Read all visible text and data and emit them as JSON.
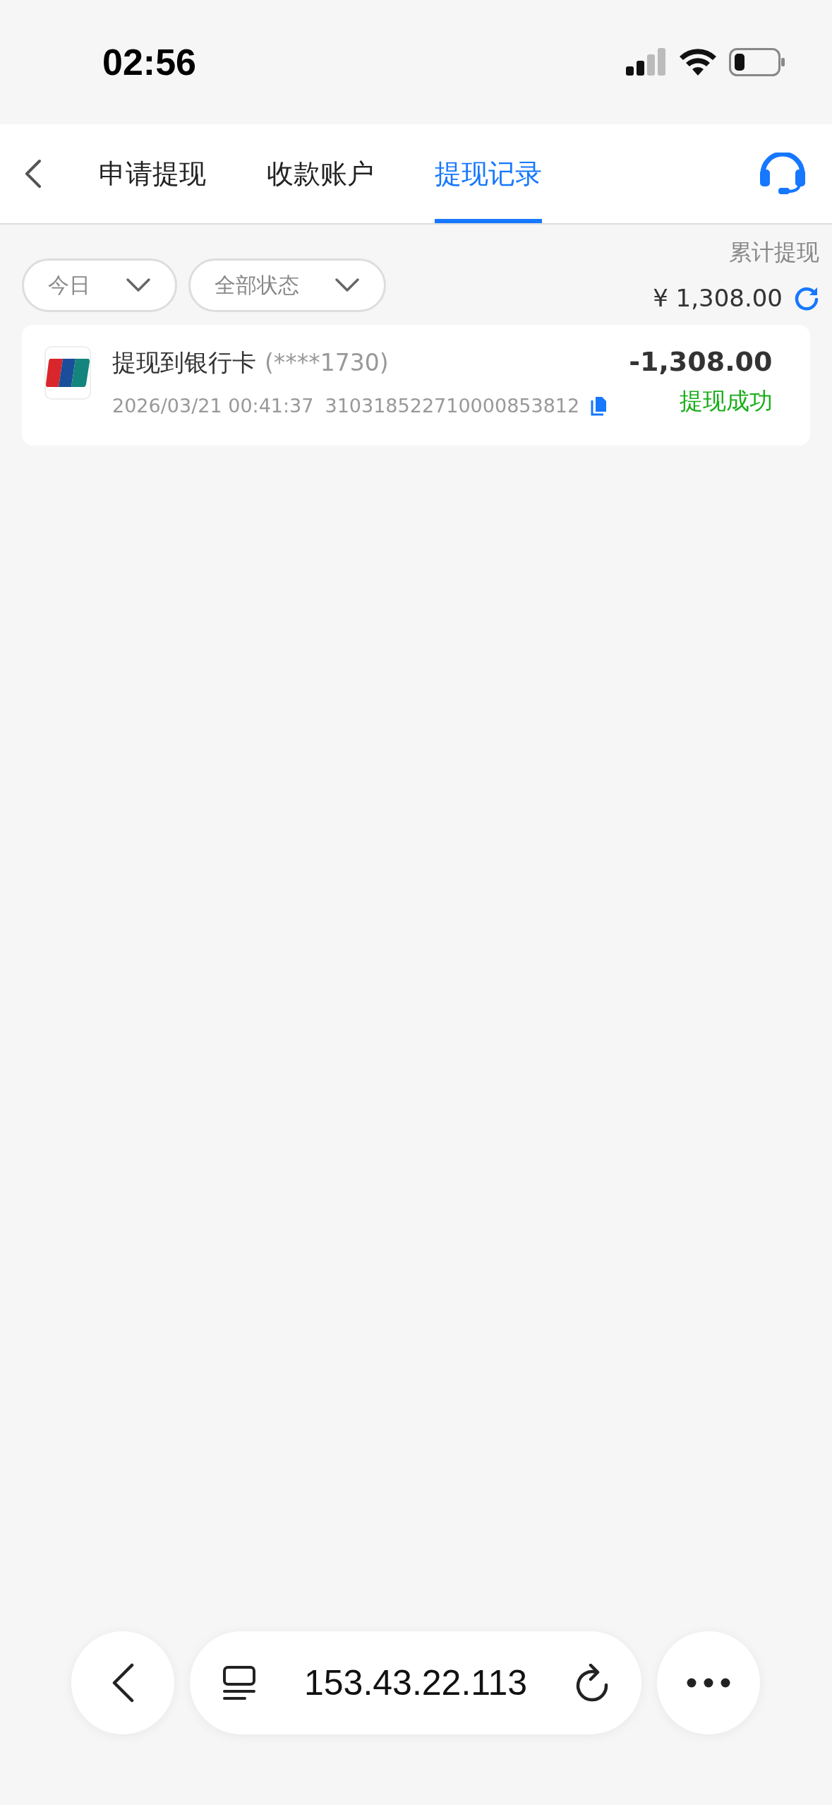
{
  "status_bar": {
    "time": "02:56"
  },
  "tabs": [
    {
      "label": "申请提现",
      "selected": false
    },
    {
      "label": "收款账户",
      "selected": false
    },
    {
      "label": "提现记录",
      "selected": true
    }
  ],
  "filters": [
    {
      "label": "今日"
    },
    {
      "label": "全部状态"
    }
  ],
  "total": {
    "label": "累计提现",
    "amount": "¥ 1,308.00"
  },
  "records": [
    {
      "title": "提现到银行卡",
      "account": "(****1730)",
      "time": "2026/03/21 00:41:37",
      "serial": "310318522710000853812",
      "amount": "-1,308.00",
      "status": "提现成功"
    }
  ],
  "browser_bar": {
    "address": "153.43.22.113"
  }
}
